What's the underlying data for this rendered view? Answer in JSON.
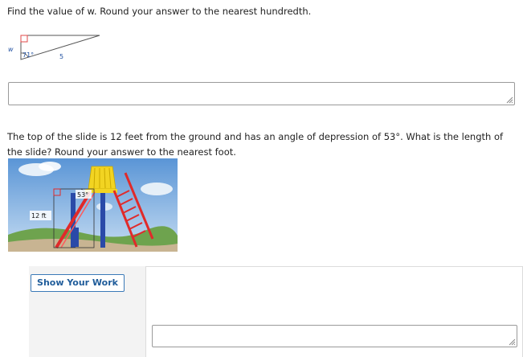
{
  "question1": {
    "prompt": "Find the value of w. Round your answer to the nearest hundredth.",
    "figure": {
      "side_label_w": "w",
      "angle_label": "71°",
      "side_label_hyp": "5"
    },
    "answer_value": ""
  },
  "question2": {
    "prompt": "The top of the slide is 12 feet from the ground and has an angle of depression of 53°. What is the length of the slide? Round your answer to the nearest foot.",
    "figure": {
      "angle_label": "53°",
      "height_label": "12 ft"
    },
    "show_work_label": "Show Your Work",
    "answer_value": ""
  }
}
